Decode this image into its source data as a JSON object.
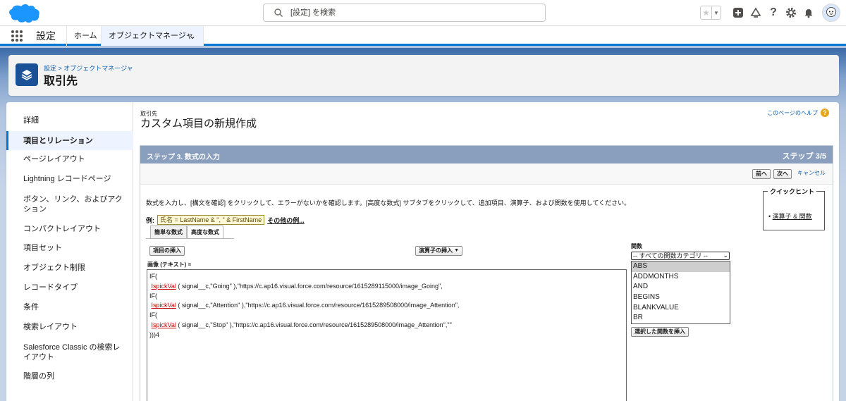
{
  "header": {
    "search_placeholder": "[設定] を検索"
  },
  "context": {
    "app_name": "設定",
    "tabs": [
      {
        "label": "ホーム"
      },
      {
        "label": "オブジェクトマネージャ"
      }
    ]
  },
  "page_header": {
    "breadcrumb": "設定 > オブジェクトマネージャ",
    "title": "取引先"
  },
  "sidebar": {
    "items": [
      {
        "label": "詳細"
      },
      {
        "label": "項目とリレーション"
      },
      {
        "label": "ページレイアウト"
      },
      {
        "label": "Lightning レコードページ"
      },
      {
        "label": "ボタン、リンク、およびアクション"
      },
      {
        "label": "コンパクトレイアウト"
      },
      {
        "label": "項目セット"
      },
      {
        "label": "オブジェクト制限"
      },
      {
        "label": "レコードタイプ"
      },
      {
        "label": "条件"
      },
      {
        "label": "検索レイアウト"
      },
      {
        "label": "Salesforce Classic の検索レイアウト"
      },
      {
        "label": "階層の列"
      }
    ]
  },
  "content": {
    "object_label": "取引先",
    "title": "カスタム項目の新規作成",
    "help_link": "このページのヘルプ",
    "help_icon": "?",
    "step_title": "ステップ 3. 数式の入力",
    "step_counter": "ステップ 3/5",
    "buttons": {
      "prev": "前へ",
      "next": "次へ",
      "cancel": "キャンセル"
    },
    "instructions": "数式を入力し、[構文を確認] をクリックして、エラーがないかを確認します。[高度な数式] サブタブをクリックして、追加項目、演算子、および関数を使用してください。",
    "quick_hints": {
      "title": "クイックヒント",
      "link": "演算子 & 関数"
    },
    "example": {
      "label": "例:",
      "expression": "氏名 = LastName & \", \" & FirstName",
      "more_link": "その他の例..."
    },
    "subtabs": [
      "簡単な数式",
      "高度な数式"
    ],
    "insert_field": "項目の挿入",
    "insert_operator": "演算子の挿入",
    "field_label": "画像 (テキスト) =",
    "formula": {
      "lines": [
        {
          "text": "IF("
        },
        {
          "pre": " ",
          "fn": "IspickVal",
          "text": " ( signal__c,\"Going\" ),\"https://c.ap16.visual.force.com/resource/1615289115000/image_Going\","
        },
        {
          "text": "IF("
        },
        {
          "pre": " ",
          "fn": "IspickVal",
          "text": " ( signal__c,\"Attention\" ),\"https://c.ap16.visual.force.com/resource/1615289508000/image_Attention\","
        },
        {
          "text": "IF("
        },
        {
          "pre": " ",
          "fn": "IspickVal",
          "text": " ( signal__c,\"Stop\" ),\"https://c.ap16.visual.force.com/resource/1615289508000/image_Attention\",\"\""
        },
        {
          "text": ")))4"
        }
      ]
    },
    "functions": {
      "label": "関数",
      "category": "-- すべての関数カテゴリ --",
      "items": [
        "ABS",
        "ADDMONTHS",
        "AND",
        "BEGINS",
        "BLANKVALUE",
        "BR"
      ],
      "selected": "ABS",
      "insert_button": "選択した関数を挿入"
    }
  },
  "colors": {
    "brand_blue": "#0176d3",
    "step_bar": "#8a9ebe",
    "help_orange": "#e7a51b"
  }
}
